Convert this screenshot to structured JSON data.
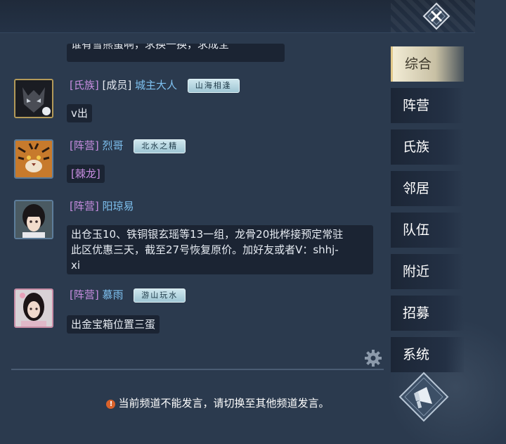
{
  "header": {
    "close_icon": "close-diamond-icon"
  },
  "chat": {
    "partial_message": "谁有雪熊蛋啊，求换一换，求成全",
    "messages": [
      {
        "channel": "[氏族]",
        "rank": "[成员]",
        "name": "城主大人",
        "title": "山海相逢",
        "text": "v出",
        "avatar": "wolf-avatar"
      },
      {
        "channel": "[阵营]",
        "name": "烈哥",
        "title": "北水之精",
        "text": "[棘龙]",
        "avatar": "tiger-avatar"
      },
      {
        "channel": "[阵营]",
        "name": "阳琼易",
        "text_lines": [
          "出仓玉10、铁铜银玄瑶等13一组，龙骨20批桦接预定常驻",
          "此区优惠三天，截至27号恢复原价。加好友或者V：shhj-",
          "xi"
        ],
        "avatar": "girl-avatar"
      },
      {
        "channel": "[阵营]",
        "name": "慕雨",
        "title": "游山玩水",
        "text": "出金宝箱位置三蛋",
        "avatar": "woman-avatar"
      }
    ]
  },
  "notice": "当前频道不能发言，请切换至其他频道发言。",
  "sidebar": {
    "active": "综合",
    "tabs": [
      "综合",
      "阵营",
      "氏族",
      "邻居",
      "队伍",
      "附近",
      "招募",
      "系统"
    ]
  },
  "colors": {
    "background": "#2b3a4e",
    "channel": "#c78de0",
    "name": "#7ec1f0",
    "bubble": "#1b2433",
    "active_tab": "#f2ecd5"
  }
}
